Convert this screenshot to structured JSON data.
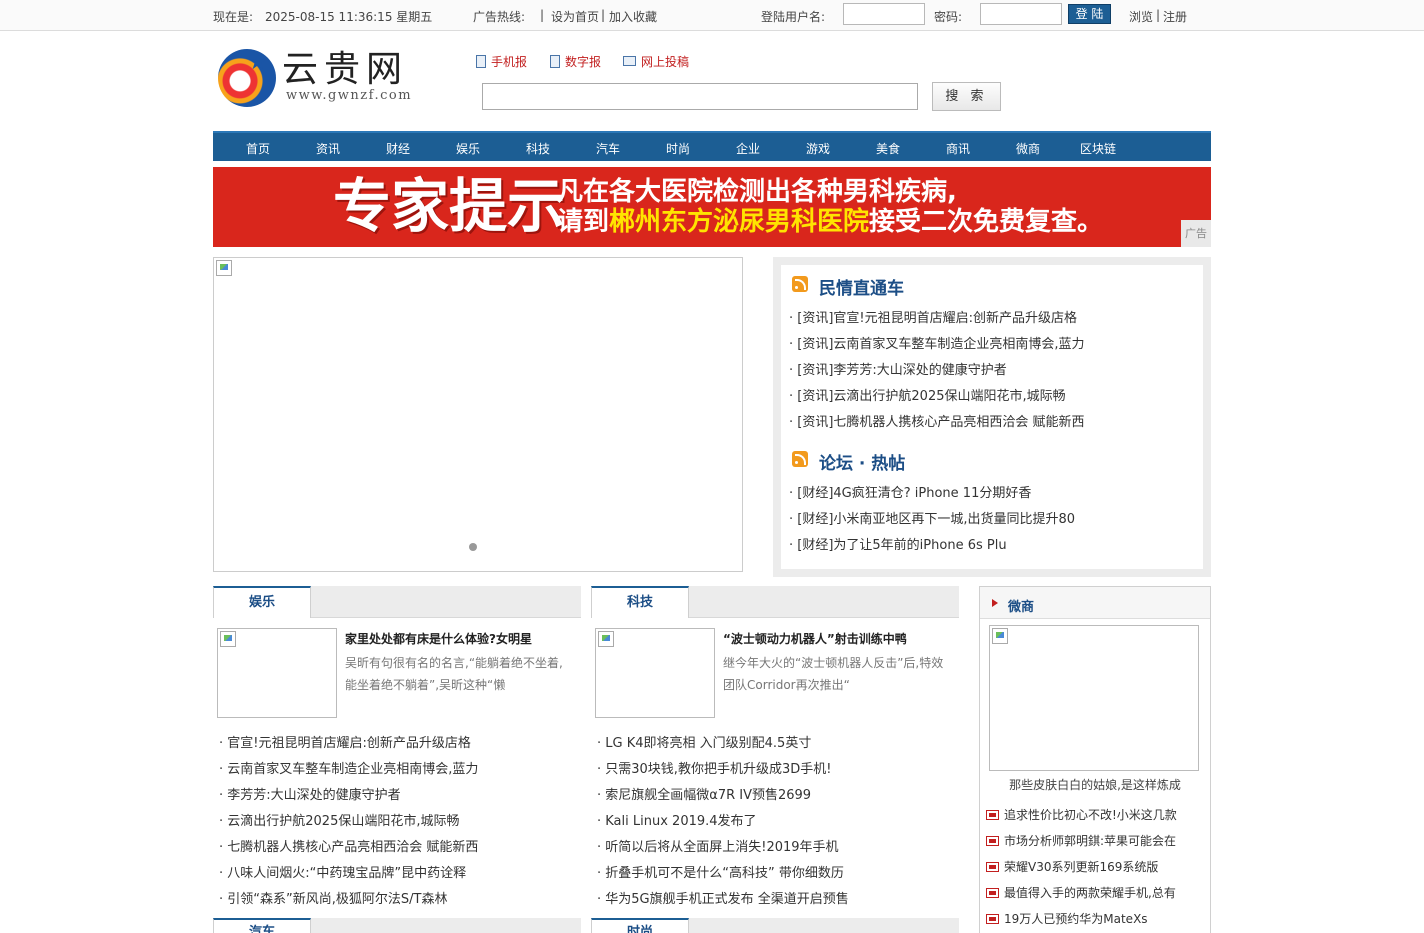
{
  "topbar": {
    "now_label": "现在是:",
    "datetime": "2025-08-15 11:36:15 星期五",
    "ad_hotline": "广告热线:",
    "sep": "|",
    "set_home": "设为首页",
    "add_fav": "加入收藏",
    "user_label": "登陆用户名:",
    "pwd_label": "密码:",
    "login_btn": "登 陆",
    "browse": "浏览",
    "register": "注册"
  },
  "header": {
    "logo_text": "云贵网",
    "logo_url": "www.gwnzf.com",
    "links": [
      "手机报",
      "数字报",
      "网上投稿"
    ],
    "search_btn": "搜 索"
  },
  "nav": [
    "首页",
    "资讯",
    "财经",
    "娱乐",
    "科技",
    "汽车",
    "时尚",
    "企业",
    "游戏",
    "美食",
    "商讯",
    "微商",
    "区块链"
  ],
  "banner": {
    "big": "专家提示",
    "line1": "凡在各大医院检测出各种男科疾病,",
    "line2_pre": "请到",
    "line2_hl": "郴州东方泌尿男科医院",
    "line2_post": "接受二次免费复查。",
    "ad_label": "广告"
  },
  "rbox": {
    "sec1_title": "民情直通车",
    "sec1_items": [
      "· [资讯]官宣!元祖昆明首店耀启:创新产品升级店格",
      "· [资讯]云南首家叉车整车制造企业亮相南博会,蓝力",
      "· [资讯]李芳芳:大山深处的健康守护者",
      "· [资讯]云滴出行护航2025保山端阳花市,城际畅",
      "· [资讯]七腾机器人携核心产品亮相西洽会 赋能新西"
    ],
    "sec2_title": "论坛 · 热帖",
    "sec2_items": [
      "· [财经]4G疯狂清仓? iPhone 11分期好香",
      "· [财经]小米南亚地区再下一城,出货量同比提升80",
      "· [财经]为了让5年前的iPhone 6s Plu"
    ]
  },
  "col_yule": {
    "tab": "娱乐",
    "feat_title": "家里处处都有床是什么体验?女明星",
    "feat_desc": "吴昕有句很有名的名言,“能躺着绝不坐着,能坐着绝不躺着”,吴昕这种“懒",
    "items": [
      "· 官宣!元祖昆明首店耀启:创新产品升级店格",
      "· 云南首家叉车整车制造企业亮相南博会,蓝力",
      "· 李芳芳:大山深处的健康守护者",
      "· 云滴出行护航2025保山端阳花市,城际畅",
      "· 七腾机器人携核心产品亮相西洽会 赋能新西",
      "· 八味人间烟火:“中药瑰宝品牌”昆中药诠释",
      "· 引领“森系”新风尚,极狐阿尔法S/T森林"
    ],
    "next_tab": "汽车"
  },
  "col_keji": {
    "tab": "科技",
    "feat_title": "“波士顿动力机器人”射击训练中鸭",
    "feat_desc": "继今年大火的“波士顿机器人反击”后,特效团队Corridor再次推出“",
    "items": [
      "· LG K4即将亮相 入门级别配4.5英寸",
      "· 只需30块钱,教你把手机升级成3D手机!",
      "· 索尼旗舰全画幅微α7R IV预售2699",
      "· Kali Linux 2019.4发布了",
      "· 听简以后将从全面屏上消失!2019年手机",
      "· 折叠手机可不是什么“高科技” 带你细数历",
      "· 华为5G旗舰手机正式发布 全渠道开启预售"
    ],
    "next_tab": "时尚"
  },
  "weishang": {
    "title": "微商",
    "caption": "那些皮肤白白的姑娘,是这样炼成",
    "items": [
      "追求性价比初心不改!小米这几款",
      "市场分析师郭明錤:苹果可能会在",
      "荣耀V30系列更新169系统版",
      "最值得入手的两款荣耀手机,总有",
      "19万人已预约华为MateXs"
    ]
  }
}
